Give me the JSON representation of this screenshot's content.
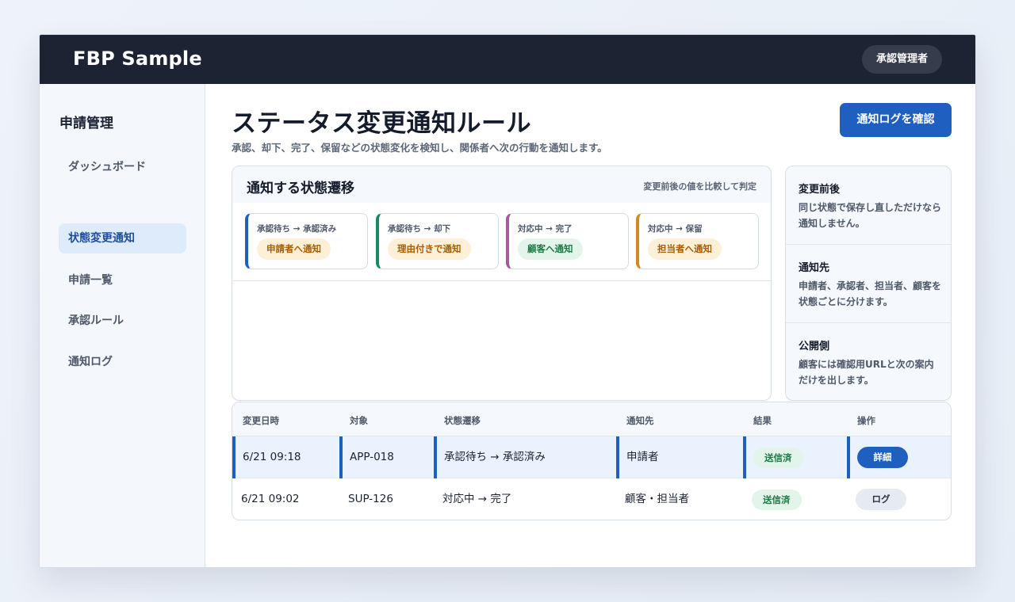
{
  "app": {
    "brand": "FBP Sample",
    "role": "承認管理者"
  },
  "sidebar": {
    "title": "申請管理",
    "items": [
      {
        "label": "ダッシュボード"
      },
      {
        "label": "状態変更通知",
        "active": true
      },
      {
        "label": "申請一覧"
      },
      {
        "label": "承認ルール"
      },
      {
        "label": "通知ログ"
      }
    ]
  },
  "page": {
    "title": "ステータス変更通知ルール",
    "subtitle": "承認、却下、完了、保留などの状態変化を検知し、関係者へ次の行動を通知します。",
    "primary_action": "通知ログを確認"
  },
  "panel": {
    "title": "通知する状態遷移",
    "note": "変更前後の値を比較して判定",
    "cards": [
      {
        "transition": "承認待ち → 承認済み",
        "badge": "申請者へ通知",
        "accent": "#1f5fbf",
        "badge_bg": "#fdf0d7",
        "badge_fg": "#a85d00"
      },
      {
        "transition": "承認待ち → 却下",
        "badge": "理由付きで通知",
        "accent": "#168a63",
        "badge_bg": "#fdf0d7",
        "badge_fg": "#a85d00"
      },
      {
        "transition": "対応中 → 完了",
        "badge": "顧客へ通知",
        "accent": "#a45a9c",
        "badge_bg": "#e3f5ea",
        "badge_fg": "#1d7a45"
      },
      {
        "transition": "対応中 → 保留",
        "badge": "担当者へ通知",
        "accent": "#d08a1f",
        "badge_bg": "#fdf0d7",
        "badge_fg": "#a85d00"
      }
    ]
  },
  "info": [
    {
      "title": "変更前後",
      "body": "同じ状態で保存し直しただけなら通知しません。"
    },
    {
      "title": "通知先",
      "body": "申請者、承認者、担当者、顧客を状態ごとに分けます。"
    },
    {
      "title": "公開側",
      "body": "顧客には確認用URLと次の案内だけを出します。"
    }
  ],
  "table": {
    "headers": [
      "変更日時",
      "対象",
      "状態遷移",
      "通知先",
      "結果",
      "操作"
    ],
    "rows": [
      {
        "datetime": "6/21 09:18",
        "target": "APP-018",
        "transition": "承認待ち → 承認済み",
        "recipient": "申請者",
        "result": "送信済",
        "action": "詳細",
        "selected": true
      },
      {
        "datetime": "6/21 09:02",
        "target": "SUP-126",
        "transition": "対応中 → 完了",
        "recipient": "顧客・担当者",
        "result": "送信済",
        "action": "ログ",
        "selected": false
      }
    ]
  }
}
